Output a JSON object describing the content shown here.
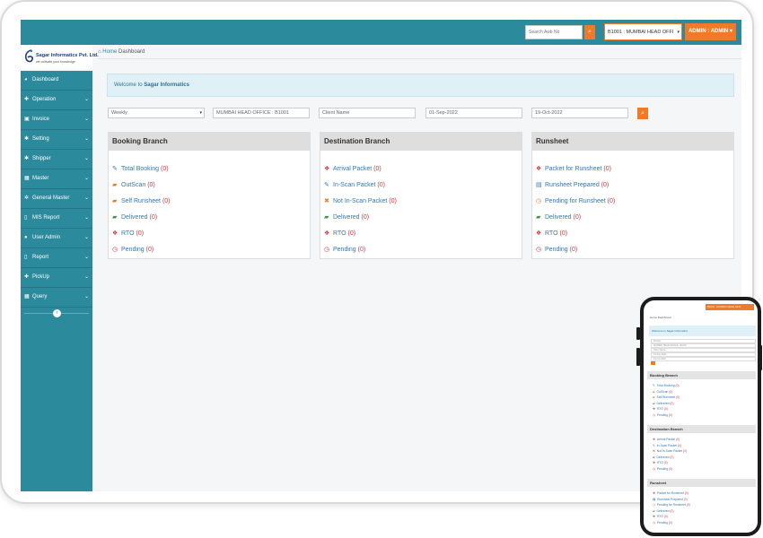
{
  "topbar": {
    "search_placeholder": "Search Awb No",
    "search_icon": "search-icon",
    "branch_selected": "B1001 : MUMBAI HEAD OFFI",
    "admin_label": "ADMIN : ADMIN"
  },
  "logo": {
    "company": "Sagar Informatics Pvt. Ltd.",
    "tagline": "we cultivate your knowledge"
  },
  "breadcrumb": {
    "home": "Home",
    "current": "Dashboard"
  },
  "sidebar": {
    "items": [
      {
        "label": "Dashboard",
        "icon": "dashboard-icon",
        "glyph": "◕",
        "chevron": false
      },
      {
        "label": "Operation",
        "icon": "plus-icon",
        "glyph": "✚",
        "chevron": true
      },
      {
        "label": "Invoice",
        "icon": "invoice-icon",
        "glyph": "▣",
        "chevron": true
      },
      {
        "label": "Setting",
        "icon": "gear-icon",
        "glyph": "✱",
        "chevron": true
      },
      {
        "label": "Shipper",
        "icon": "shipper-icon",
        "glyph": "✱",
        "chevron": true
      },
      {
        "label": "Master",
        "icon": "calendar-icon",
        "glyph": "▦",
        "chevron": true
      },
      {
        "label": "General Master",
        "icon": "cogs-icon",
        "glyph": "✲",
        "chevron": true
      },
      {
        "label": "MIS Report",
        "icon": "file-icon",
        "glyph": "▯",
        "chevron": true
      },
      {
        "label": "User Admin",
        "icon": "user-icon",
        "glyph": "●",
        "chevron": true
      },
      {
        "label": "Report",
        "icon": "report-icon",
        "glyph": "▯",
        "chevron": true
      },
      {
        "label": "PickUp",
        "icon": "plus-icon",
        "glyph": "✚",
        "chevron": true
      },
      {
        "label": "Query",
        "icon": "calendar-icon",
        "glyph": "▦",
        "chevron": true
      }
    ]
  },
  "welcome": {
    "prefix": "Welcome to ",
    "company": "Sagar Informatics"
  },
  "filters": {
    "period": "Weekly",
    "branch": "MUMBAI HEAD OFFICE : B1001",
    "client_placeholder": "Client Name",
    "from_date": "01-Sep-2022",
    "to_date": "19-Oct-2022"
  },
  "panels": [
    {
      "title": "Booking Branch",
      "rows": [
        {
          "label": "Total Booking",
          "count": "(0)",
          "icon": "edit-icon",
          "glyph": "✎",
          "color": "#2f78b7"
        },
        {
          "label": "OutScan",
          "count": "(0)",
          "icon": "truck-icon",
          "glyph": "▰",
          "color": "#f07a27"
        },
        {
          "label": "Self Runsheet",
          "count": "(0)",
          "icon": "truck-icon",
          "glyph": "▰",
          "color": "#f07a27"
        },
        {
          "label": "Delivered",
          "count": "(0)",
          "icon": "truck-icon",
          "glyph": "▰",
          "color": "#3c9a3c"
        },
        {
          "label": "RTO",
          "count": "(0)",
          "icon": "gift-icon",
          "glyph": "❖",
          "color": "#d9363e"
        },
        {
          "label": "Pending",
          "count": "(0)",
          "icon": "clock-icon",
          "glyph": "◷",
          "color": "#d9363e"
        }
      ]
    },
    {
      "title": "Destination Branch",
      "rows": [
        {
          "label": "Arrival Packet",
          "count": "(0)",
          "icon": "gift-icon",
          "glyph": "❖",
          "color": "#d9363e"
        },
        {
          "label": "In-Scan Packet",
          "count": "(0)",
          "icon": "edit-icon",
          "glyph": "✎",
          "color": "#2f78b7"
        },
        {
          "label": "Not In-Scan Packet",
          "count": "(0)",
          "icon": "close-icon",
          "glyph": "✖",
          "color": "#f07a27"
        },
        {
          "label": "Delivered",
          "count": "(0)",
          "icon": "truck-icon",
          "glyph": "▰",
          "color": "#3c9a3c"
        },
        {
          "label": "RTO",
          "count": "(0)",
          "icon": "gift-icon",
          "glyph": "❖",
          "color": "#d9363e"
        },
        {
          "label": "Pending",
          "count": "(0)",
          "icon": "clock-icon",
          "glyph": "◷",
          "color": "#d9363e"
        }
      ]
    },
    {
      "title": "Runsheet",
      "rows": [
        {
          "label": "Packet for Runsheet",
          "count": "(0)",
          "icon": "gift-icon",
          "glyph": "❖",
          "color": "#d9363e"
        },
        {
          "label": "Runsheet Prepared",
          "count": "(0)",
          "icon": "document-icon",
          "glyph": "▤",
          "color": "#2f78b7"
        },
        {
          "label": "Pending for Runsheet",
          "count": "(0)",
          "icon": "clock-icon",
          "glyph": "◷",
          "color": "#f07a27"
        },
        {
          "label": "Delivered",
          "count": "(0)",
          "icon": "truck-icon",
          "glyph": "▰",
          "color": "#3c9a3c"
        },
        {
          "label": "RTO",
          "count": "(0)",
          "icon": "gift-icon",
          "glyph": "❖",
          "color": "#d9363e"
        },
        {
          "label": "Pending",
          "count": "(0)",
          "icon": "clock-icon",
          "glyph": "◷",
          "color": "#d9363e"
        }
      ]
    }
  ],
  "colors": {
    "primary": "#2b8a9c",
    "accent": "#f07a27",
    "link": "#2f78b7",
    "count": "#d9363e"
  },
  "phone": {
    "branch_selected": "B1001 : MUMBAI HEAD OFFI",
    "breadcrumb": "Home  Dashboard",
    "welcome": "Welcome to Sagar Informatics",
    "filters": [
      "Weekly",
      "MUMBAI HEAD OFFICE : B1001",
      "Client Name",
      "01-Sep-2022",
      "19-Oct-2022"
    ]
  }
}
